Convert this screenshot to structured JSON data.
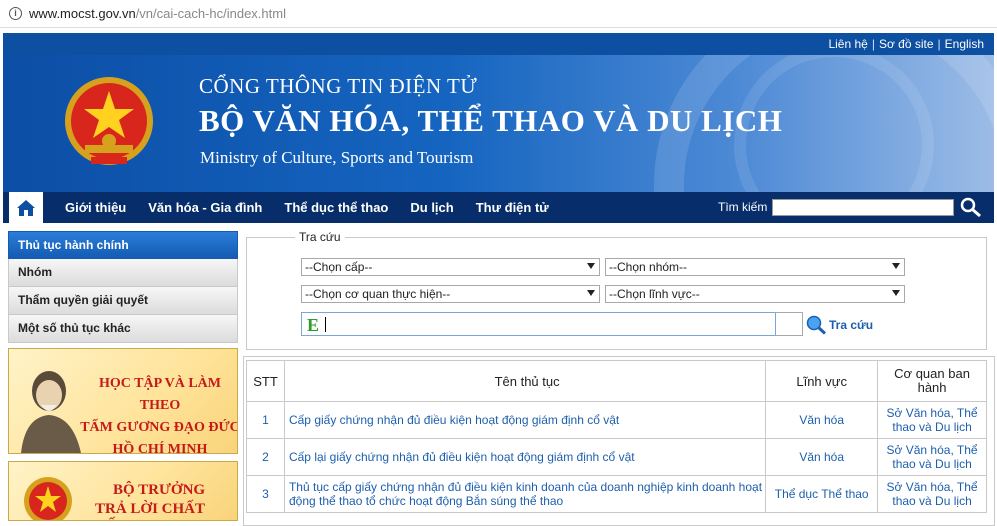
{
  "browser": {
    "url_domain": "www.mocst.gov.vn",
    "url_path": "/vn/cai-cach-hc/index.html"
  },
  "topbar": {
    "contact": "Liên hệ",
    "sitemap": "Sơ đồ site",
    "english": "English"
  },
  "header": {
    "line1": "CỔNG THÔNG TIN ĐIỆN TỬ",
    "line2": "BỘ VĂN HÓA, THỂ THAO VÀ DU LỊCH",
    "line3": "Ministry of Culture, Sports and Tourism"
  },
  "nav": {
    "items": [
      "Giới thiệu",
      "Văn hóa - Gia đình",
      "Thể dục thể thao",
      "Du lịch",
      "Thư điện tử"
    ],
    "search_label": "Tìm kiếm"
  },
  "sidebar": {
    "items": [
      "Thủ tục hành chính",
      "Nhóm",
      "Thẩm quyền giải quyết",
      "Một số thủ tục khác"
    ],
    "promo1": [
      "HỌC TẬP VÀ LÀM THEO",
      "TẤM GƯƠNG ĐẠO ĐỨC",
      "HỒ CHÍ MINH"
    ],
    "promo2": [
      "BỘ TRƯỞNG",
      "TRẢ LỜI CHẤT VẤN"
    ]
  },
  "search_form": {
    "legend": "Tra cứu",
    "select_level": "--Chọn cấp--",
    "select_group": "--Chọn nhóm--",
    "select_agency": "--Chọn cơ quan thực hiện--",
    "select_field": "--Chọn lĩnh vực--",
    "keyword_value": "",
    "search_button": "Tra cứu"
  },
  "table": {
    "headers": [
      "STT",
      "Tên thủ tục",
      "Lĩnh vực",
      "Cơ quan ban hành"
    ],
    "rows": [
      {
        "stt": "1",
        "name": "Cấp giấy chứng nhận đủ điều kiện hoạt động giám định cổ vật",
        "field": "Văn hóa",
        "org": "Sở Văn hóa, Thể thao và Du lịch"
      },
      {
        "stt": "2",
        "name": "Cấp lại giấy chứng nhận đủ điều kiện hoạt động giám định cổ vật",
        "field": "Văn hóa",
        "org": "Sở Văn hóa, Thể thao và Du lịch"
      },
      {
        "stt": "3",
        "name": "Thủ tục cấp giấy chứng nhận đủ điều kiện kinh doanh của doanh nghiệp kinh doanh hoạt động thể thao tổ chức hoạt động Bắn súng thể thao",
        "field": "Thể dục Thể thao",
        "org": "Sở Văn hóa, Thể thao và Du lịch"
      }
    ]
  },
  "colors": {
    "brand_blue": "#0d4fa1",
    "nav_dark": "#072e6a",
    "link_blue": "#1d5fae",
    "promo_red": "#c41a1a"
  }
}
